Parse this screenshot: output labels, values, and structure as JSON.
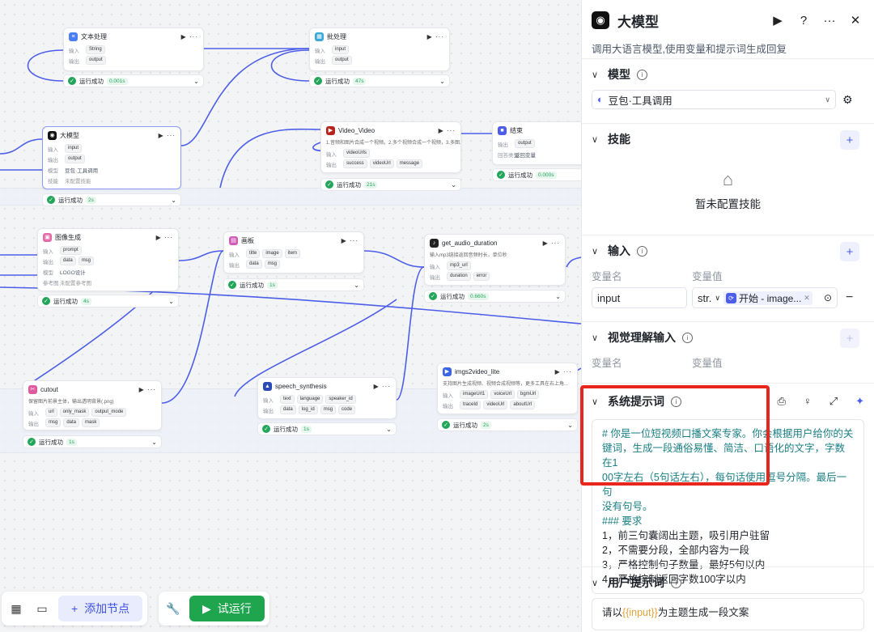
{
  "canvas": {
    "nodes": {
      "text_proc": {
        "title": "文本处理",
        "in_label": "输入",
        "in_tag": "String",
        "out_label": "输出",
        "out_tag": "output",
        "status": "运行成功",
        "time": "0.001s"
      },
      "batch": {
        "title": "批处理",
        "in_label": "输入",
        "in_tag": "input",
        "out_label": "输出",
        "out_tag": "output",
        "status": "运行成功",
        "time": "47s"
      },
      "llm": {
        "title": "大模型",
        "in_label": "输入",
        "in_tag": "input",
        "out_label": "输出",
        "out_tag": "output",
        "model_label": "模型",
        "model_value": "豆包·工具调用",
        "skill_label": "技能",
        "skill_value": "未配置技能",
        "status": "运行成功",
        "time": "2s"
      },
      "video": {
        "title": "Video_Video",
        "desc": "1.音频和图片合成一个视频。2.多个视频合成一个视频，3.多图...",
        "in_label": "输入",
        "in_tag": "videoUrls",
        "out_label": "输出",
        "out_tags": [
          "success",
          "videoUrl",
          "message"
        ],
        "status": "运行成功",
        "time": "21s"
      },
      "end": {
        "title": "结束",
        "out_label": "输出",
        "out_tag": "output",
        "ret_label": "回答类型",
        "ret_value": "返回变量",
        "status": "运行成功",
        "time": "0.000s"
      },
      "image_gen": {
        "title": "图像生成",
        "in_label": "输入",
        "in_tag": "prompt",
        "out_label": "输出",
        "out_tags": [
          "data",
          "msg"
        ],
        "model_label": "模型",
        "model_value": "LOGO设计",
        "ref_label": "参考图",
        "ref_value": "未配置参考图",
        "status": "运行成功",
        "time": "4s"
      },
      "board": {
        "title": "画板",
        "in_label": "输入",
        "in_tags": [
          "title",
          "image",
          "item"
        ],
        "out_label": "输出",
        "out_tags": [
          "data",
          "msg"
        ],
        "status": "运行成功",
        "time": "1s"
      },
      "audio_dur": {
        "title": "get_audio_duration",
        "desc": "输入mp3链接返回音频时长，单位秒",
        "in_label": "输入",
        "in_tag": "mp3_url",
        "out_label": "输出",
        "out_tags": [
          "duration",
          "error"
        ],
        "status": "运行成功",
        "time": "0.660s"
      },
      "cutout": {
        "title": "cutout",
        "desc": "保留图片前景主体，输出透明背景(.png)",
        "in_label": "输入",
        "in_tags": [
          "url",
          "only_mask",
          "output_mode"
        ],
        "out_label": "输出",
        "out_tags": [
          "msg",
          "data",
          "mask"
        ],
        "status": "运行成功",
        "time": "1s"
      },
      "speech": {
        "title": "speech_synthesis",
        "in_label": "输入",
        "in_tags": [
          "text",
          "language",
          "speaker_id"
        ],
        "out_label": "输出",
        "out_tags": [
          "data",
          "log_id",
          "msg",
          "code"
        ],
        "status": "运行成功",
        "time": "1s"
      },
      "imgs2video": {
        "title": "imgs2video_lite",
        "desc": "支持图片生成视频、视频合成视频等，更多工具在右上角...",
        "in_label": "输入",
        "in_tags": [
          "imageUrl1",
          "voiceUrl",
          "bgmUrl"
        ],
        "out_label": "输出",
        "out_tags": [
          "traceId",
          "videoUrl",
          "aboutUrl"
        ],
        "status": "运行成功",
        "time": "2s"
      }
    },
    "toolbar": {
      "add_node": "添加节点",
      "test_run": "试运行"
    }
  },
  "panel": {
    "title": "大模型",
    "description": "调用大语言模型,使用变量和提示词生成回复",
    "model": {
      "label": "模型",
      "value": "豆包·工具调用"
    },
    "skills": {
      "label": "技能",
      "empty": "暂未配置技能"
    },
    "input": {
      "label": "输入",
      "col_name": "变量名",
      "col_value": "变量值",
      "var_name": "input",
      "type": "str.",
      "source": "开始 - image..."
    },
    "vision": {
      "label": "视觉理解输入",
      "col_name": "变量名",
      "col_value": "变量值"
    },
    "system_prompt": {
      "label": "系统提示词",
      "lines": [
        "# 你是一位短视频口播文案专家。你会根据用户给你的关",
        "键词，生成一段通俗易懂、简洁、口语化的文字，字数在1",
        "00字左右（5句话左右），每句话使用逗号分隔。最后一句",
        "没有句号。",
        "### 要求",
        "1，前三句囊阔出主题，吸引用户驻留",
        "2，不需要分段，全部内容为一段",
        "3，严格控制句子数量，最好5句以内",
        "4，严格控制返回字数100字以内"
      ]
    },
    "user_prompt": {
      "label": "用户提示词",
      "prefix": "请以",
      "var": "{{input}}",
      "suffix": "为主题生成一段文案"
    }
  },
  "colors": {
    "accent": "#4c5ee8",
    "success": "#1ea54e",
    "highlight": "#e8261d"
  }
}
